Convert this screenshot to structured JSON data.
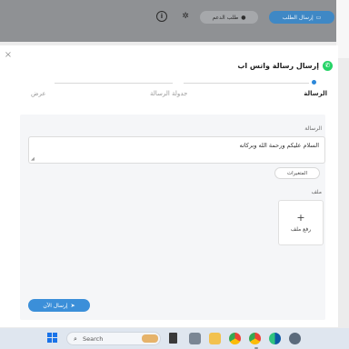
{
  "header": {
    "primary_button": "إرسال الطلب",
    "secondary_button": "طلب الدعم"
  },
  "modal": {
    "title": "إرسال رسالة واتس اب",
    "close_glyph": "×",
    "steps": [
      {
        "label": "الرسالة",
        "active": true
      },
      {
        "label": "جدولة الرسالة",
        "active": false
      },
      {
        "label": "عرض",
        "active": false
      }
    ],
    "message_label": "الرسالة",
    "message_value": "السلام عليكم ورحمة الله وبركاته",
    "variables_button": "المتغيرات",
    "file_label": "ملف",
    "upload_label": "رفع ملف",
    "send_button": "إرسال الآن"
  },
  "taskbar": {
    "search_placeholder": "Search",
    "apps": [
      "widgets",
      "file-explorer",
      "camera",
      "folder",
      "chrome",
      "chrome-profile",
      "edge",
      "settings"
    ]
  },
  "colors": {
    "accent": "#3b8fd9",
    "whatsapp": "#25d366",
    "overlay": "#8f9194"
  }
}
